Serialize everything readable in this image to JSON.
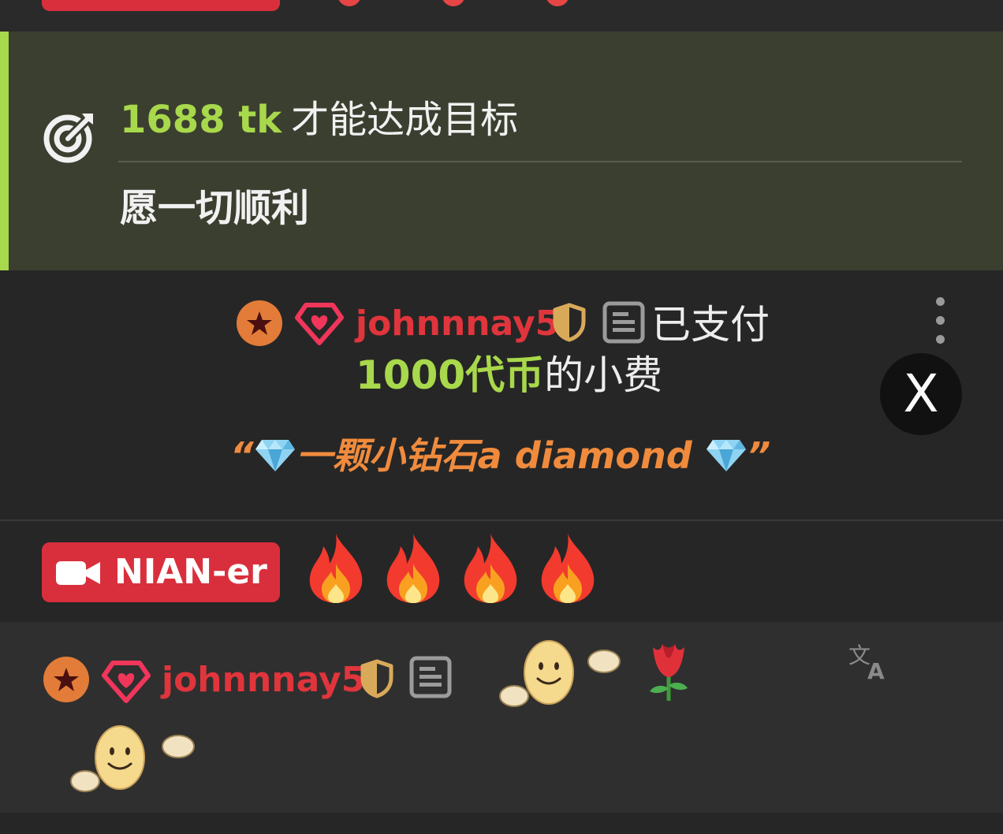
{
  "goal": {
    "amount": "1688 tk",
    "text": "才能达成目标",
    "wish": "愿一切顺利",
    "accent_color": "#a8d84b",
    "icon": "target-icon"
  },
  "tip": {
    "username": "johnnnay5",
    "paid_text": "已支付",
    "amount": "1000代币",
    "suffix": "的小费",
    "message": "“💎一颗小钻石a diamond 💎”",
    "message_parts": {
      "open_quote": "“",
      "text": "一颗小钻石a diamond",
      "close_quote": "”"
    },
    "close_button": "X",
    "icons": [
      "star-icon",
      "diamond-heart-icon",
      "shield-icon",
      "document-icon",
      "more-options-icon"
    ]
  },
  "streamer": {
    "name": "NIAN-er",
    "badge_color": "#d92f3c",
    "reactions": [
      "fire",
      "fire",
      "fire",
      "fire"
    ]
  },
  "chat_message": {
    "username": "johnnnay5",
    "username_color": "#e0353c",
    "content_emotes": [
      "smiley-emote",
      "rose",
      "smiley-emote"
    ],
    "translate_icon": "translate-icon"
  }
}
